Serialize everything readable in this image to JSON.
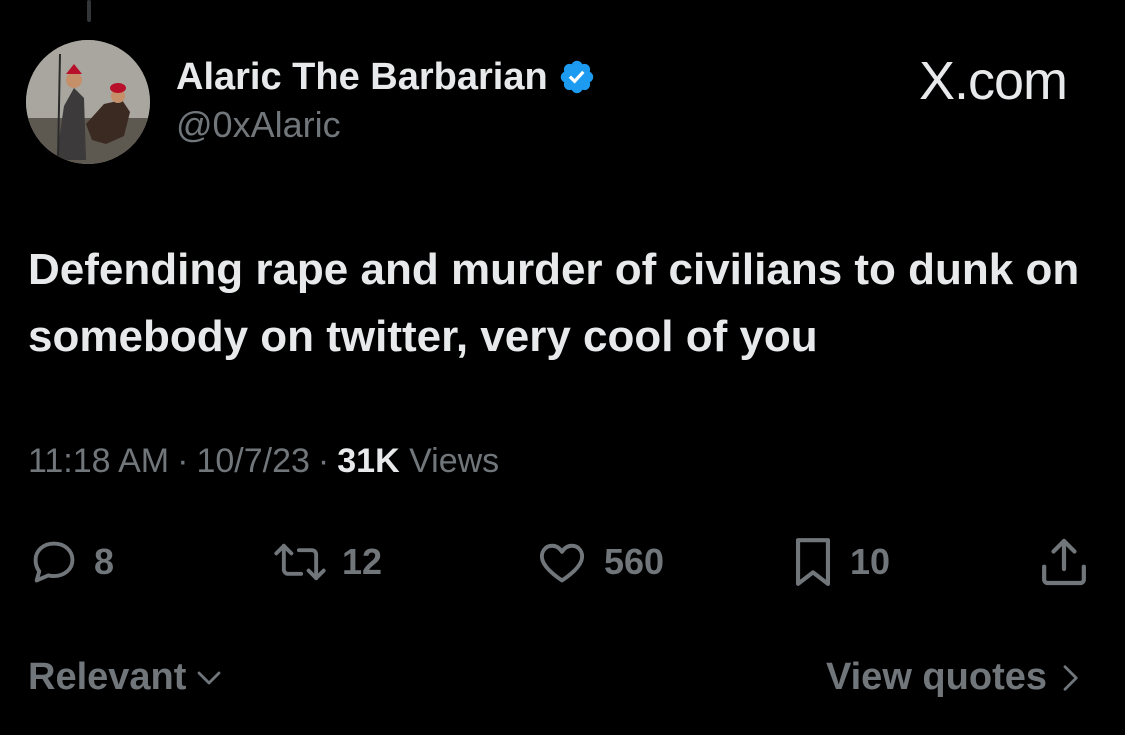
{
  "header": {
    "display_name": "Alaric The Barbarian",
    "handle": "@0xAlaric",
    "verified_icon": "verified-badge-icon",
    "brand": "X.com"
  },
  "tweet": {
    "text": "Defending rape and murder of civilians to dunk on somebody on twitter, very cool of you",
    "time": "11:18 AM",
    "date": "10/7/23",
    "views_count": "31K",
    "views_label": "Views"
  },
  "actions": {
    "replies": "8",
    "reposts": "12",
    "likes": "560",
    "bookmarks": "10"
  },
  "footer": {
    "sort_label": "Relevant",
    "quotes_label": "View quotes"
  },
  "colors": {
    "background": "#000000",
    "primary_text": "#e7e9ea",
    "secondary_text": "#71767b",
    "verified_blue": "#1d9bf0"
  }
}
